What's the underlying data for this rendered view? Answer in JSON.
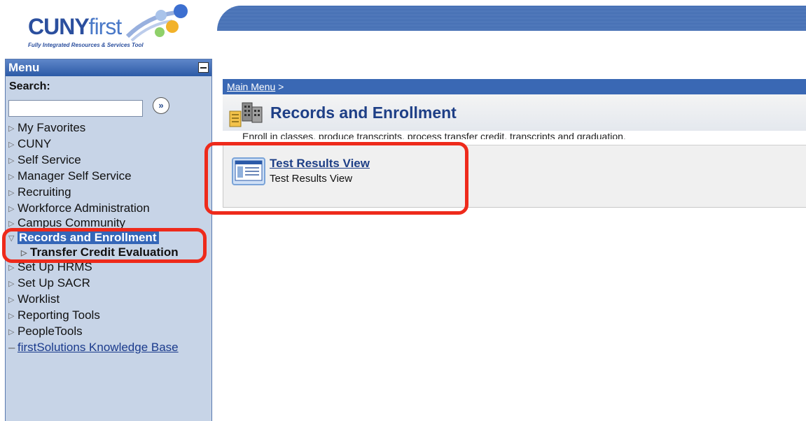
{
  "logo": {
    "brand_bold": "CUNY",
    "brand_light": "first",
    "tagline": "Fully Integrated Resources & Services Tool"
  },
  "menu": {
    "title": "Menu",
    "search_label": "Search:",
    "search_value": "",
    "go_glyph": "»",
    "items": [
      {
        "label": "My Favorites",
        "state": "collapsed"
      },
      {
        "label": "CUNY",
        "state": "collapsed"
      },
      {
        "label": "Self Service",
        "state": "collapsed"
      },
      {
        "label": "Manager Self Service",
        "state": "collapsed"
      },
      {
        "label": "Recruiting",
        "state": "collapsed"
      },
      {
        "label": "Workforce Administration",
        "state": "collapsed"
      },
      {
        "label": "Campus Community",
        "state": "collapsed"
      },
      {
        "label": "Records and Enrollment",
        "state": "expanded-selected"
      },
      {
        "label": "Transfer Credit Evaluation",
        "state": "sub"
      },
      {
        "label": "Set Up HRMS",
        "state": "collapsed"
      },
      {
        "label": "Set Up SACR",
        "state": "collapsed"
      },
      {
        "label": "Worklist",
        "state": "collapsed"
      },
      {
        "label": "Reporting Tools",
        "state": "collapsed"
      },
      {
        "label": "PeopleTools",
        "state": "collapsed"
      },
      {
        "label": "firstSolutions Knowledge Base",
        "state": "link"
      }
    ]
  },
  "main": {
    "breadcrumb_link": "Main Menu",
    "breadcrumb_sep": ">",
    "page_title": "Records and Enrollment",
    "description": "Enroll in classes, produce transcripts, process transfer credit, transcripts and graduation.",
    "item_title": "Test Results View",
    "item_description": "Test Results View"
  },
  "colors": {
    "menu_bg": "#c7d4e7",
    "header_blue": "#3a68b4",
    "selected_blue": "#3466b8",
    "title_blue": "#1e3f86",
    "annotation_red": "#ee2a1b"
  },
  "icons": {
    "go": "double-chevron-right-icon",
    "collapse": "minus-icon",
    "page": "records-building-icon",
    "item": "window-component-icon",
    "tree_collapsed": "triangle-right-icon",
    "tree_expanded": "triangle-down-icon"
  }
}
